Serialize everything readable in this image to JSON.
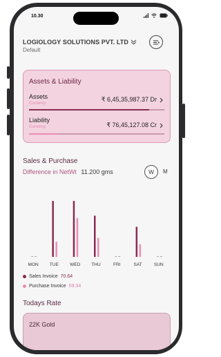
{
  "status": {
    "time": "10.30"
  },
  "header": {
    "company": "LOGIOLOGY SOLUTIONS PVT. LTD",
    "subtitle": "Default"
  },
  "assets_card": {
    "title": "Assets & Liability",
    "rows": [
      {
        "label": "Assets",
        "sub": "Currency",
        "amount": "₹ 6,45,35,987.37 Dr",
        "fill": 0.89,
        "color": "#8a2b52"
      },
      {
        "label": "Liability",
        "sub": "Currency",
        "amount": "₹ 76,45,127.08 Cr",
        "fill": 0.22,
        "color": "#ea8db4"
      }
    ]
  },
  "sales": {
    "title": "Sales & Purchase",
    "diff_label": "Difference in NetWt",
    "diff_value": "11.200 gms",
    "period_w": "W",
    "period_m": "M"
  },
  "chart_data": {
    "type": "bar",
    "categories": [
      "MON",
      "TUE",
      "WED",
      "THU",
      "FRI",
      "SAT",
      "SUN"
    ],
    "series": [
      {
        "name": "Sales Invoice",
        "values": [
          0,
          70.64,
          70.64,
          52,
          0,
          38,
          0
        ],
        "color": "#8a2b52"
      },
      {
        "name": "Purchase Invoice",
        "values": [
          0,
          19,
          49,
          24,
          0,
          16,
          0
        ],
        "color": "#ea8db4"
      }
    ],
    "ylim": [
      0,
      75
    ]
  },
  "legend": {
    "sales_label": "Sales Invoice",
    "sales_value": "70.64",
    "purchase_label": "Purchase Invoice",
    "purchase_value": "59.34"
  },
  "rates": {
    "title": "Todays Rate",
    "first_card": "22K Gold"
  }
}
